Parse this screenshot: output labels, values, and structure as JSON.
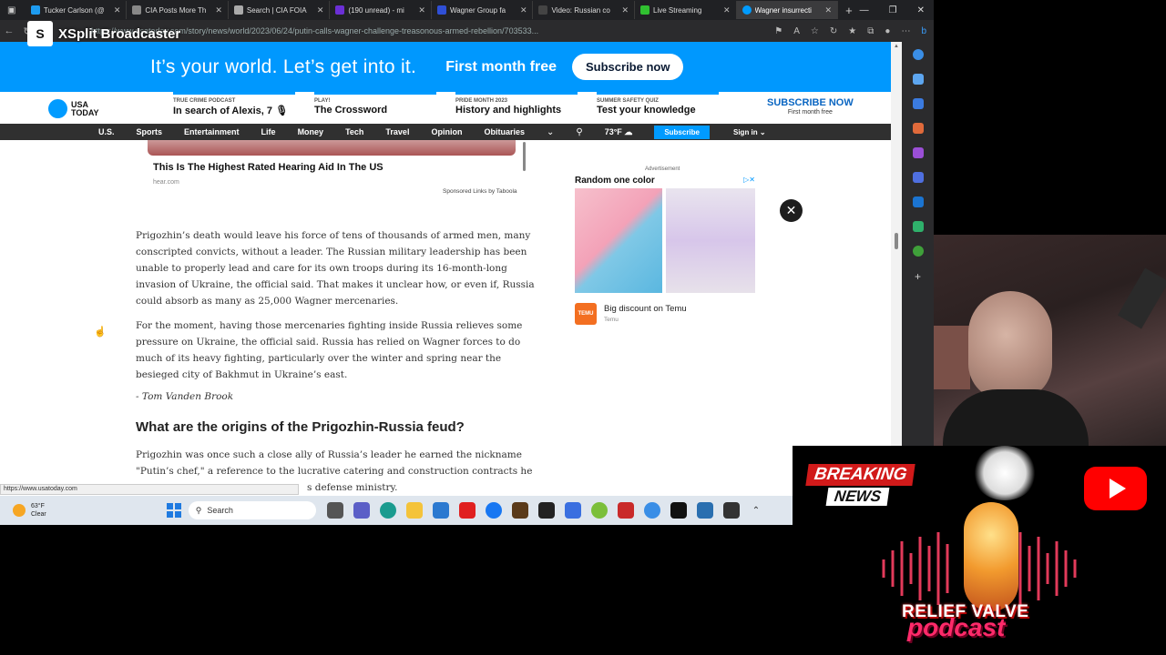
{
  "browser": {
    "tabs": [
      {
        "label": "Tucker Carlson (@",
        "color": "#1d9bf0"
      },
      {
        "label": "CIA Posts More Th",
        "color": "#888888"
      },
      {
        "label": "Search | CIA FOIA",
        "color": "#aaaaaa"
      },
      {
        "label": "(190 unread) - mi",
        "color": "#6b2fd6"
      },
      {
        "label": "Wagner Group fa",
        "color": "#2f4fd6"
      },
      {
        "label": "Video: Russian co",
        "color": "#444444"
      },
      {
        "label": "Live Streaming",
        "color": "#30c030"
      },
      {
        "label": "Wagner insurrecti",
        "color": "#009bff",
        "active": true
      }
    ],
    "url": "https://www.usatoday.com/story/news/world/2023/06/24/putin-calls-wagner-challenge-treasonous-armed-rebellion/703533...",
    "status_url": "https://www.usatoday.com"
  },
  "xsplit": {
    "name": "XSplit Broadcaster"
  },
  "banner": {
    "tagline": "It’s your world. Let’s get into it.",
    "offer": "First month free",
    "button": "Subscribe now"
  },
  "subhead": {
    "logo_line1": "USA",
    "logo_line2": "TODAY",
    "promos": [
      {
        "kicker": "TRUE CRIME PODCAST",
        "title": "In search of Alexis, 7 🎙"
      },
      {
        "kicker": "PLAY!",
        "title": "The Crossword"
      },
      {
        "kicker": "PRIDE MONTH 2023",
        "title": "History and highlights"
      },
      {
        "kicker": "SUMMER SAFETY QUIZ",
        "title": "Test your knowledge"
      }
    ],
    "subscribe_now": "SUBSCRIBE NOW",
    "subscribe_sub": "First month free"
  },
  "nav": {
    "items": [
      "U.S.",
      "Sports",
      "Entertainment",
      "Life",
      "Money",
      "Tech",
      "Travel",
      "Opinion",
      "Obituaries"
    ],
    "temp": "73°F",
    "subscribe": "Subscribe",
    "signin": "Sign in"
  },
  "top_ad": {
    "title": "This Is The Highest Rated Hearing Aid In The US",
    "source": "hear.com",
    "sponsored": "Sponsored Links by Taboola"
  },
  "article": {
    "p1": "Prigozhin’s death would leave his force of tens of thousands of armed men, many conscripted convicts, without a leader. The Russian military leadership has been unable to properly lead and care for its own troops during its 16-month-long invasion of Ukraine, the official said. That makes it unclear how, or even if, Russia could absorb as many as 25,000 Wagner mercenaries.",
    "p2": "For the moment, having those mercenaries fighting inside Russia relieves some pressure on Ukraine, the official said. Russia has relied on Wagner forces to do much of its heavy fighting, particularly over the winter and spring near the besieged city of Bakhmut in Ukraine’s east.",
    "byline": "- Tom Vanden Brook",
    "h2": "What are the origins of the Prigozhin-Russia feud?",
    "p3": "Prigozhin was once such a close ally of Russia’s leader he earned the nickname \"Putin’s chef,\" a reference to the lucrative catering and construction contracts he",
    "p3_tail": "s defense ministry."
  },
  "side_ad": {
    "advertisement": "Advertisement",
    "header": "Random one color",
    "brand": "TEMU",
    "title": "Big discount on Temu",
    "source": "Temu"
  },
  "taskbar": {
    "temp": "63°F",
    "condition": "Clear",
    "search": "Search"
  },
  "overlay": {
    "breaking": "BREAKING",
    "news": "NEWS",
    "brand1": "RELIEF VALVE",
    "brand2": "podcast"
  }
}
